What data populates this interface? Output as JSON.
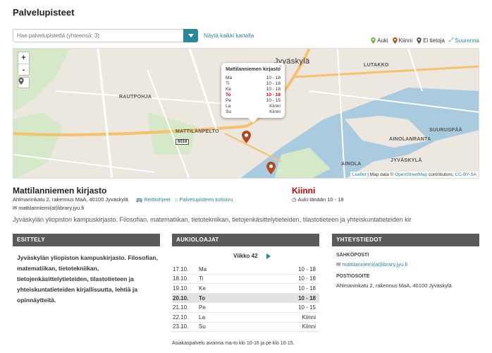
{
  "page": {
    "title": "Palvelupisteet"
  },
  "search": {
    "placeholder": "Hae palvelupistettä (yhteensä: 3)",
    "show_all_label": "Näytä kaikki kartalla"
  },
  "legend": {
    "open_label": "Auki",
    "closed_label": "Kiinni",
    "unknown_label": "Ei tietoja",
    "expand_label": "Suurenna",
    "colors": {
      "open": "#6db33f",
      "closed": "#b5471c",
      "unknown": "#555555",
      "accent": "#29889c"
    }
  },
  "map": {
    "city_label": "Jyväskylä",
    "districts": [
      "MATTILANPELTO",
      "RAUTPOHJA",
      "LUTAKKO",
      "SUURUSPÄÄ",
      "AINOLANRANTA",
      "AINOLA",
      "JYVÄSKYLÄ"
    ],
    "road_sign": "6018",
    "attribution": {
      "leaflet": "Leaflet",
      "map_data": "| Map data ©",
      "osm": "OpenStreetMap",
      "contributors": "contributors,",
      "license": "CC-BY-SA"
    },
    "popup": {
      "title": "Mattilanniemen kirjasto",
      "rows": [
        {
          "day": "Ma",
          "hours": "10 - 18"
        },
        {
          "day": "Ti",
          "hours": "10 - 18"
        },
        {
          "day": "Ke",
          "hours": "10 - 18"
        },
        {
          "day": "To",
          "hours": "10 - 18"
        },
        {
          "day": "Pe",
          "hours": "10 - 15"
        },
        {
          "day": "La",
          "hours": "Kiinni"
        },
        {
          "day": "Su",
          "hours": "Kiinni"
        }
      ]
    }
  },
  "library": {
    "name": "Mattilanniemen kirjasto",
    "address": "Ahlmaninkatu 2, rakennus MaA, 40100 Jyväskylä",
    "directions_label": "Reittiohjeet",
    "homepage_label": "Palvelupisteen kotisivu",
    "email": "mattilanniemi(at)library.jyu.fi",
    "status": "Kiinni",
    "today_hours": "Auki tänään 10 - 18",
    "intro": "Jyväskylän yliopiston kampuskirjasto. Filosofian, matematiikan, tietotekniikan, tietojenkäsittelytieteiden, tilastotieteen ja yhteiskuntatieteiden kir"
  },
  "panels": {
    "intro_title": "ESITTELY",
    "hours_title": "AUKIOLOAJAT",
    "contact_title": "YHTEYSTIEDOT"
  },
  "description": "Jyväskylän yliopiston kampuskirjasto. Filosofian, matematiikan, tietotekniikan, tietojenkäsittelytieteiden, tilastotieteen ja yhteiskuntatieteiden kirjallisuutta, lehtiä ja opinnäytteitä.",
  "hours": {
    "week_label": "Viikko 42",
    "rows": [
      {
        "date": "17.10.",
        "weekday": "Ma",
        "hours": "10 - 18"
      },
      {
        "date": "18.10.",
        "weekday": "Ti",
        "hours": "10 - 18"
      },
      {
        "date": "19.10.",
        "weekday": "Ke",
        "hours": "10 - 18"
      },
      {
        "date": "20.10.",
        "weekday": "To",
        "hours": "10 - 18"
      },
      {
        "date": "21.10.",
        "weekday": "Pe",
        "hours": "10 - 15"
      },
      {
        "date": "22.10.",
        "weekday": "La",
        "hours": "Kiinni"
      },
      {
        "date": "23.10.",
        "weekday": "Su",
        "hours": "Kiinni"
      }
    ],
    "note": "Asiakaspalvelu avoinna ma-to klo 10-16 ja pe klo 10-15."
  },
  "contact": {
    "email_label": "SÄHKÖPOSTI",
    "email": "mattilanniemi(at)library.jyu.fi",
    "address_label": "POSTIOSOITE",
    "address": "Ahlmaninkatu 2, rakennus MaA, 40100 Jyväskylä"
  }
}
